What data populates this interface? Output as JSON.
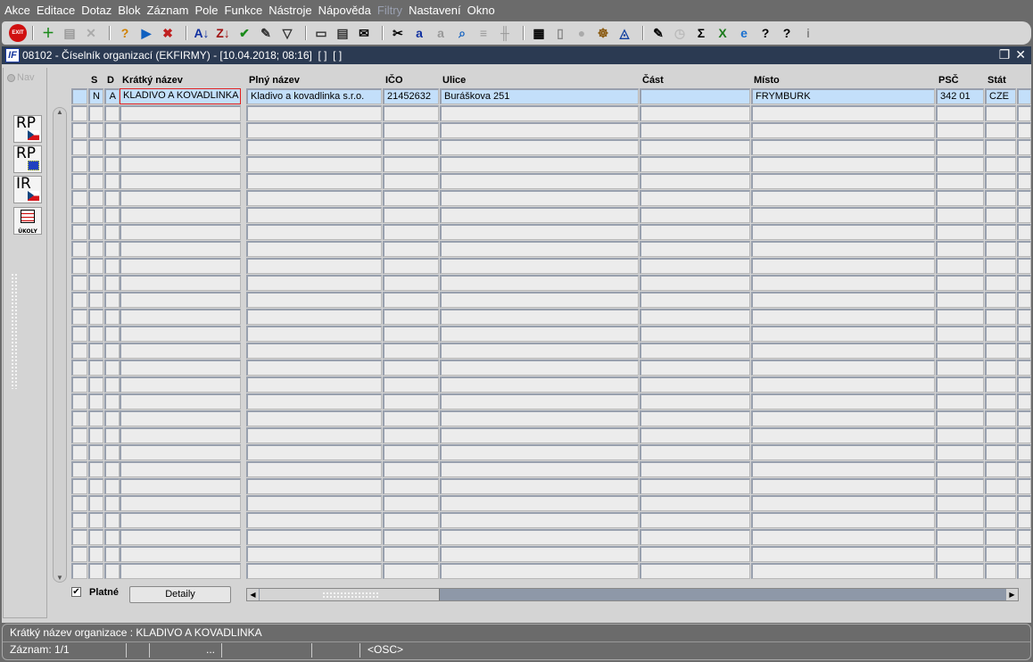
{
  "menu": [
    "Akce",
    "Editace",
    "Dotaz",
    "Blok",
    "Záznam",
    "Pole",
    "Funkce",
    "Nástroje",
    "Nápověda",
    "Filtry",
    "Nastavení",
    "Okno"
  ],
  "toolbar": {
    "exit_label": "EXIT",
    "icons": [
      "add-record-icon",
      "copy-record-icon",
      "delete-record-icon",
      "|",
      "query-enter-icon",
      "query-execute-icon",
      "query-cancel-icon",
      "|",
      "sort-asc-icon",
      "sort-desc-icon",
      "check-icon",
      "wrench-icon",
      "filter-icon",
      "|",
      "print-icon",
      "print-preview-icon",
      "email-icon",
      "|",
      "cut-icon",
      "copy-icon",
      "paste-icon",
      "find-icon",
      "indent-icon",
      "tree-icon",
      "|",
      "import-icon",
      "document-icon",
      "globe-icon",
      "wheel-icon",
      "eye-icon",
      "|",
      "report-icon",
      "clock-icon",
      "sum-icon",
      "excel-icon",
      "ie-icon",
      "help-icon",
      "context-help-icon",
      "info-icon"
    ]
  },
  "window": {
    "title": "08102 - Číselník organizací (EKFIRMY) - [10.04.2018; 08:16]  [ ]  [ ]",
    "app_icon": "IF"
  },
  "left": {
    "nav": "Nav",
    "buttons": [
      "RP",
      "RP",
      "IR",
      "ÚKOLY"
    ]
  },
  "grid": {
    "headers": {
      "s": "S",
      "d": "D",
      "short": "Krátký název",
      "full": "Plný název",
      "ico": "IČO",
      "street": "Ulice",
      "part": "Část",
      "city": "Místo",
      "zip": "PSČ",
      "country": "Stát"
    },
    "rows": [
      {
        "s": "N",
        "d": "A",
        "short": "KLADIVO A KOVADLINKA",
        "full": "Kladivo a kovadlinka s.r.o.",
        "ico": "21452632",
        "street": "Buráškova 251",
        "part": "",
        "city": "FRYMBURK",
        "zip": "342 01",
        "country": "CZE"
      }
    ],
    "row_count": 29
  },
  "bottom": {
    "platne_label": "Platné",
    "platne_checked": true,
    "detaily": "Detaily"
  },
  "status": {
    "line1": "Krátký název organizace : KLADIVO A KOVADLINKA",
    "record": "Záznam: 1/1",
    "ellipsis": "...",
    "mode": "<OSC>"
  }
}
